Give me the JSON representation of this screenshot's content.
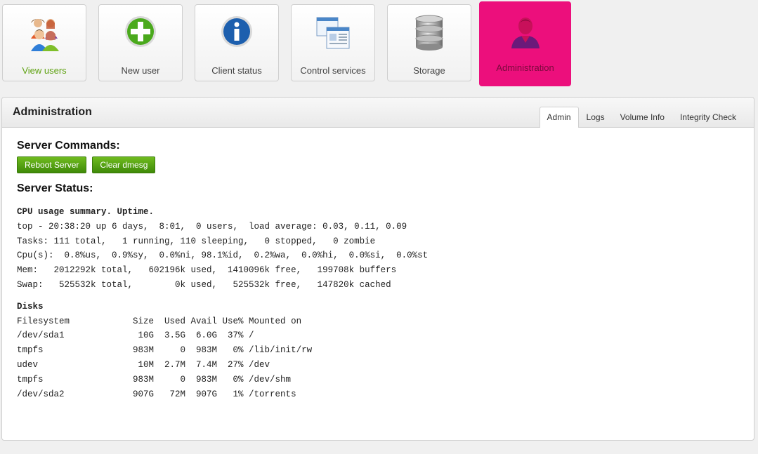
{
  "nav": [
    {
      "label": "View users",
      "icon": "users-icon"
    },
    {
      "label": "New user",
      "icon": "add-icon"
    },
    {
      "label": "Client status",
      "icon": "info-icon"
    },
    {
      "label": "Control services",
      "icon": "windows-icon"
    },
    {
      "label": "Storage",
      "icon": "database-icon"
    },
    {
      "label": "Administration",
      "icon": "admin-person-icon"
    }
  ],
  "panel": {
    "title": "Administration",
    "tabs": [
      "Admin",
      "Logs",
      "Volume Info",
      "Integrity Check"
    ],
    "active_tab": "Admin"
  },
  "commands": {
    "heading": "Server Commands:",
    "reboot_label": "Reboot Server",
    "clear_dmesg_label": "Clear dmesg"
  },
  "status": {
    "heading": "Server Status:",
    "cpu_title": "CPU usage summary. Uptime.",
    "cpu_lines": [
      "top - 20:38:20 up 6 days,  8:01,  0 users,  load average: 0.03, 0.11, 0.09",
      "Tasks: 111 total,   1 running, 110 sleeping,   0 stopped,   0 zombie",
      "Cpu(s):  0.8%us,  0.9%sy,  0.0%ni, 98.1%id,  0.2%wa,  0.0%hi,  0.0%si,  0.0%st",
      "Mem:   2012292k total,   602196k used,  1410096k free,   199708k buffers",
      "Swap:   525532k total,        0k used,   525532k free,   147820k cached"
    ],
    "disks_title": "Disks",
    "disk_lines": [
      "Filesystem            Size  Used Avail Use% Mounted on",
      "/dev/sda1              10G  3.5G  6.0G  37% /",
      "tmpfs                 983M     0  983M   0% /lib/init/rw",
      "udev                   10M  2.7M  7.4M  27% /dev",
      "tmpfs                 983M     0  983M   0% /dev/shm",
      "/dev/sda2             907G   72M  907G   1% /torrents"
    ]
  },
  "colors": {
    "active_nav": "#ec0f7c",
    "green_button": "#5ba418",
    "nav_first_label": "#5fa212"
  }
}
